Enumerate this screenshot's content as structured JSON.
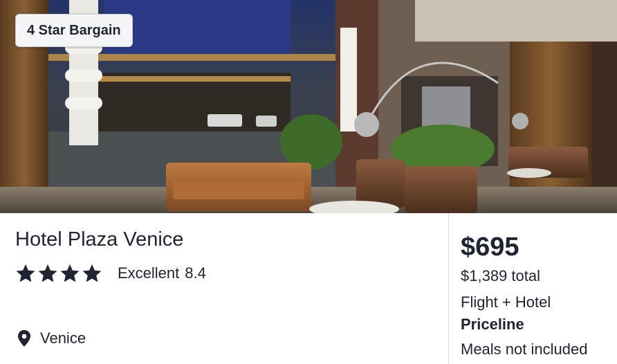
{
  "badge": {
    "label": "4 Star Bargain"
  },
  "hotel": {
    "name": "Hotel Plaza Venice",
    "star_count": 4,
    "rating_label": "Excellent",
    "rating_score": "8.4",
    "location": "Venice"
  },
  "pricing": {
    "price": "$695",
    "total": "$1,389 total",
    "package": "Flight + Hotel",
    "provider": "Priceline",
    "meals": "Meals not included"
  },
  "icons": {
    "star": "star-icon",
    "location": "map-pin-icon"
  },
  "colors": {
    "text": "#1f2430",
    "divider": "#d8dbe0",
    "badge_bg": "#f4f5f7"
  }
}
